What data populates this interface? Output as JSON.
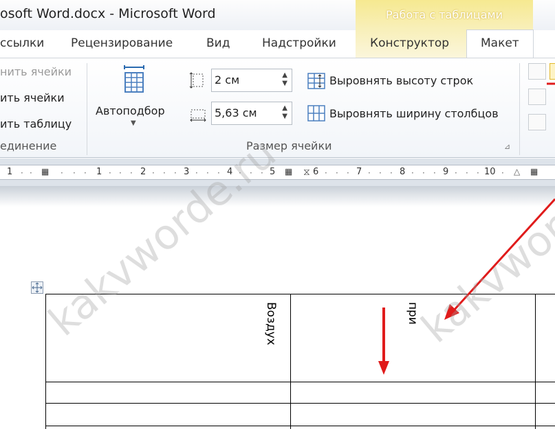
{
  "window": {
    "title": "osoft Word.docx  -  Microsoft Word",
    "context_tab_group": "Работа с таблицами"
  },
  "tabs": [
    {
      "label": "ссылки"
    },
    {
      "label": "Рецензирование"
    },
    {
      "label": "Вид"
    },
    {
      "label": "Надстройки"
    },
    {
      "label": "Конструктор"
    },
    {
      "label": "Макет"
    }
  ],
  "ribbon": {
    "merge_group": {
      "items": [
        "нить ячейки",
        "ить ячейки",
        "ить таблицу"
      ],
      "label": "единение"
    },
    "autofit": {
      "label": "Автоподбор"
    },
    "cell_size": {
      "height_value": "2 см",
      "width_value": "5,63 см",
      "distribute_rows": "Выровнять высоту строк",
      "distribute_cols": "Выровнять ширину столбцов",
      "label": "Размер ячейки"
    }
  },
  "ruler": {
    "left_nums": [
      "1",
      "1",
      "2",
      "3",
      "4",
      "5"
    ],
    "right_nums": [
      "6",
      "7",
      "8",
      "9",
      "10"
    ]
  },
  "table": {
    "cell_1_text": "Воздух",
    "cell_2_text": "при"
  },
  "watermark": "kakvworde.ru",
  "colors": {
    "accent_arrow": "#e01b1b",
    "context_tab": "#f6e990"
  }
}
